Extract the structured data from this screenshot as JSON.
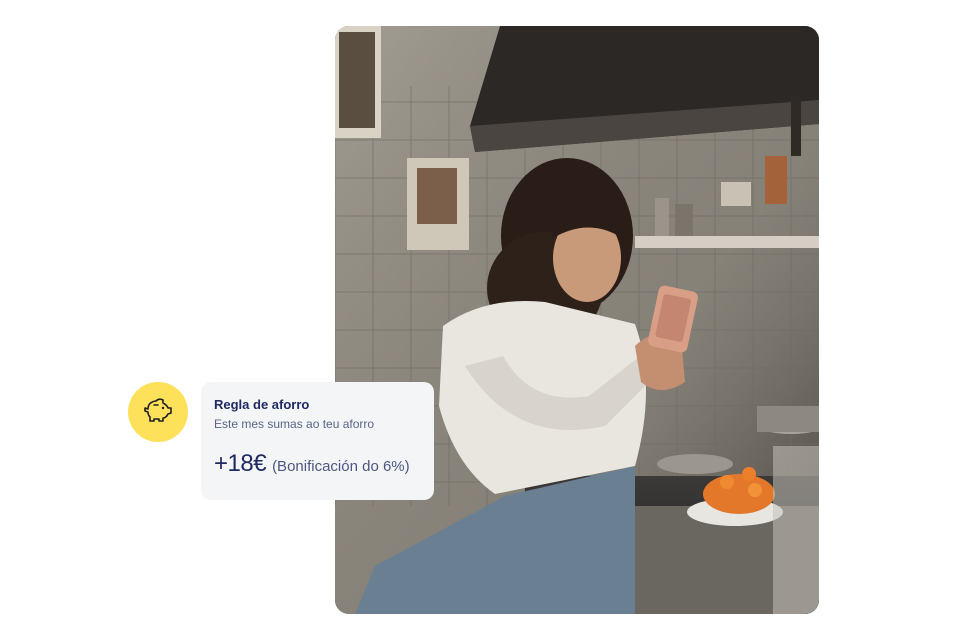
{
  "photo": {
    "description_icon": "photo"
  },
  "savings_card": {
    "icon": "piggy-bank-icon",
    "title": "Regla de aforro",
    "subtitle": "Este mes sumas ao teu aforro",
    "amount": "+18€",
    "bonus": "(Bonificación do 6%)"
  },
  "colors": {
    "badge_yellow": "#fde15a",
    "text_navy": "#1f2a63",
    "card_bg": "#f4f5f7"
  }
}
